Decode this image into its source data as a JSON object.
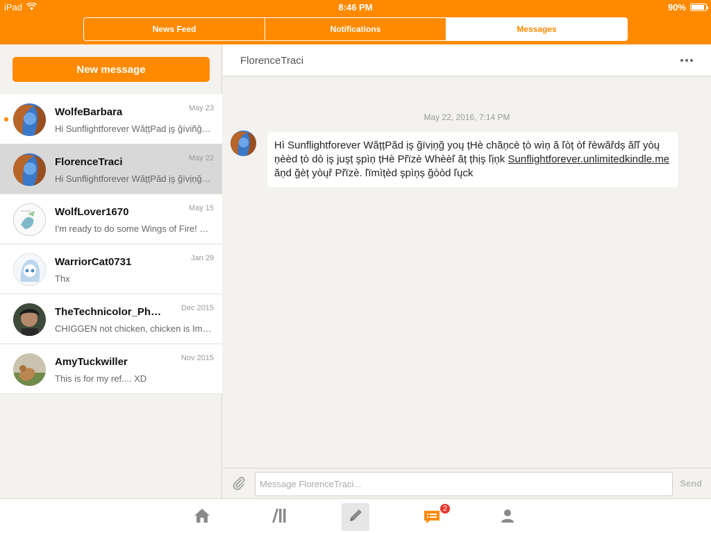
{
  "status": {
    "device": "iPad",
    "time": "8:46 PM",
    "battery": "90%",
    "battery_level": 0.9
  },
  "header": {
    "tabs": [
      {
        "label": "News Feed",
        "active": false
      },
      {
        "label": "Notifications",
        "active": false
      },
      {
        "label": "Messages",
        "active": true
      }
    ]
  },
  "sidebar": {
    "new_message_label": "New message",
    "conversations": [
      {
        "name": "WolfeBarbara",
        "date": "May 23",
        "preview": "Hi Sunflightforever  WățțPad ịş ğíviñğ yoų",
        "unread": true,
        "selected": false
      },
      {
        "name": "FlorenceTraci",
        "date": "May 22",
        "preview": "Hi Sunflightforever  WățțPăd ịş ğïvịņğ yoų",
        "unread": false,
        "selected": true
      },
      {
        "name": "WolfLover1670",
        "date": "May 15",
        "preview": "I'm ready to do some Wings of Fire! Let's do it",
        "unread": false,
        "selected": false
      },
      {
        "name": "WarriorCat0731",
        "date": "Jan 29",
        "preview": "Thx",
        "unread": false,
        "selected": false
      },
      {
        "name": "TheTechnicolor_Ph…",
        "date": "Dec 2015",
        "preview": "CHIGGEN not chicken, chicken is Improper",
        "unread": false,
        "selected": false
      },
      {
        "name": "AmyTuckwiller",
        "date": "Nov 2015",
        "preview": "This is for my ref.... XD",
        "unread": false,
        "selected": false
      }
    ]
  },
  "chat": {
    "title": "FlorenceTraci",
    "timestamp": "May 22, 2016, 7:14 PM",
    "message_text": "Hì Sunflightforever  WățțPăd ịş ğïvịņğ yoų țHè chăņcè țò wìņ ă ľòț òf řèwăřdș ăľľ yòų ņèèd țò dò ịş juşț şpìņ țHè Přïzè Whèèľ ăț țhịş ľịņk ",
    "message_link": "Sunflightforever.unlimitedkindle.me",
    "message_tail": " ăņd ğèț yòųř Přïzè. ľïmìțèd şpìņș ğòòd ľųck",
    "input_placeholder": "Message FlorenceTraci...",
    "send_label": "Send"
  },
  "tabbar": {
    "items": [
      {
        "icon": "home-icon"
      },
      {
        "icon": "library-icon"
      },
      {
        "icon": "pencil-icon",
        "active": true
      },
      {
        "icon": "messages-icon",
        "badge": "2"
      },
      {
        "icon": "profile-icon"
      }
    ]
  },
  "colors": {
    "accent": "#ff8a00",
    "badge": "#e8362c"
  }
}
